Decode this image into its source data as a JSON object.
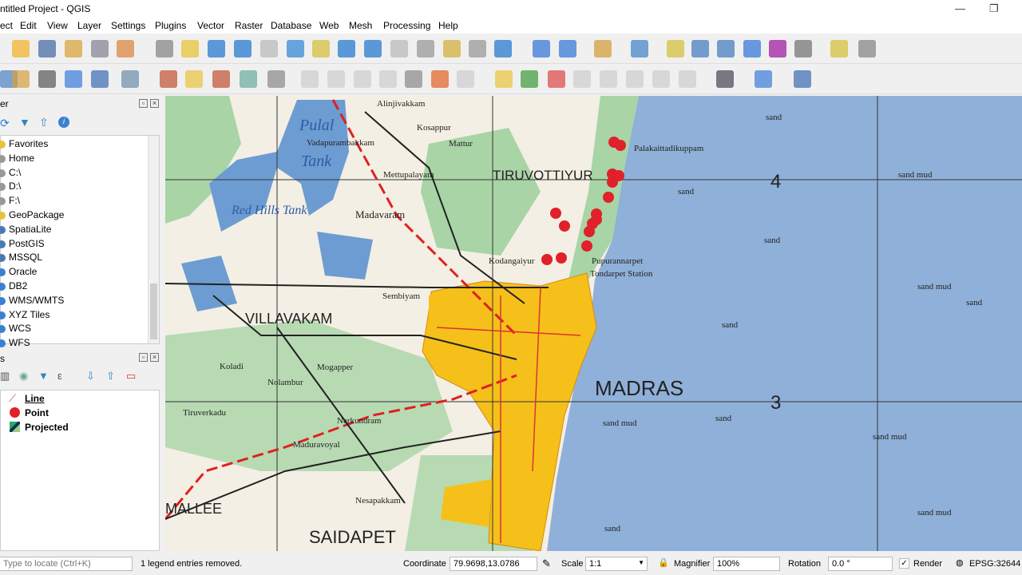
{
  "window": {
    "title": "ntitled Project - QGIS",
    "minimize": "—",
    "maximize": "❐"
  },
  "menu": [
    "ect",
    "Edit",
    "View",
    "Layer",
    "Settings",
    "Plugins",
    "Vector",
    "Raster",
    "Database",
    "Web",
    "Mesh",
    "Processing",
    "Help"
  ],
  "browser": {
    "title": "er",
    "items": [
      "Favorites",
      "Home",
      "C:\\",
      "D:\\",
      "F:\\",
      "GeoPackage",
      "SpatiaLite",
      "PostGIS",
      "MSSQL",
      "Oracle",
      "DB2",
      "WMS/WMTS",
      "XYZ Tiles",
      "WCS",
      "WFS"
    ]
  },
  "layers": {
    "title": "s",
    "items": [
      {
        "name": "Line",
        "icon": "line-layer-icon"
      },
      {
        "name": "Point",
        "icon": "point-layer-icon",
        "color": "#e0202a"
      },
      {
        "name": "Projected",
        "icon": "raster-layer-icon"
      }
    ]
  },
  "map": {
    "labels": {
      "pulal": "Pulal",
      "tank": "Tank",
      "redhills": "Red Hills Tank",
      "tiruvottiyur": "TIRUVOTTIYUR",
      "villavakam": "VILLAVAKAM",
      "madras": "MADRAS",
      "saidapet": "SAIDAPET",
      "mallee": "MALLEE",
      "madavaram": "Madavaram",
      "alinjivakkam": "Alinjivakkam",
      "palakaittadikuppam": "Palakaittadikuppam",
      "tondiarpet": "Tondarpet Station",
      "pupuranarpet": "Pupurannarpet",
      "kodungaiyur": "Kodangaiyur",
      "sembiyam": "Sembiyam",
      "mettupalayam": "Mettupalayam",
      "vadapurambakkam": "Vadapurambakkam",
      "kosappur": "Kosappur",
      "mattur": "Mattur",
      "koladi": "Koladi",
      "mogappair": "Mogapper",
      "nolambur": "Nolambur",
      "tiruverkadu": "Tiruverkadu",
      "nerkundram": "Nerkundram",
      "maduravoyal": "Maduravoyal",
      "nesapakkam": "Nesapakkam",
      "grid4": "4",
      "grid3": "3",
      "sand": "sand",
      "sandmud": "sand mud"
    },
    "colors": {
      "sea": "#8fb0d8",
      "land": "#f3efe4",
      "city": "#f5c01a",
      "veg": "#a8d4a6",
      "points": "#e0202a"
    }
  },
  "status": {
    "locate_placeholder": "Type to locate (Ctrl+K)",
    "message": "1 legend entries removed.",
    "coordinate_label": "Coordinate",
    "coordinate": "79.9698,13.0786",
    "scale_label": "Scale",
    "scale": "1:1",
    "magnifier_label": "Magnifier",
    "magnifier": "100%",
    "rotation_label": "Rotation",
    "rotation": "0.0 °",
    "render_label": "Render",
    "render_checked": true,
    "crs": "EPSG:32644"
  }
}
